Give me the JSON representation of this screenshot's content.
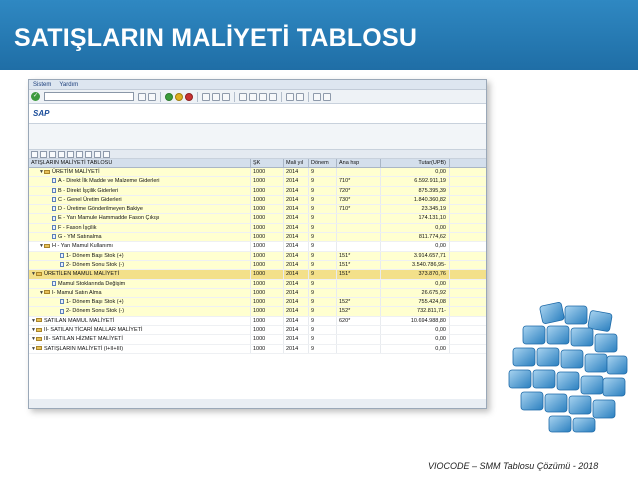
{
  "slide": {
    "title": "SATIŞLARIN MALİYETİ TABLOSU",
    "footer": "VIOCODE – SMM Tablosu Çözümü - 2018"
  },
  "sap": {
    "menu": [
      "Sistem",
      "Yardım"
    ],
    "logo": "SAP",
    "columns": {
      "name": "ATIŞLARIN MALİYETİ TABLOSU",
      "sk": "ŞK",
      "yil": "Mali yıl",
      "donem": "Dönem",
      "ana_hsp": "Ana hsp",
      "tutar": "Tutar(UPB)"
    },
    "rows": [
      {
        "indent": 1,
        "icon": "folder",
        "name": "ÜRETİM MALİYETİ",
        "sk": "1000",
        "yil": "2014",
        "donem": "9",
        "hsp": "",
        "tutar": "0,00",
        "style": "yellow"
      },
      {
        "indent": 2,
        "icon": "doc",
        "name": "A - Direkt İlk Madde ve Malzeme Giderleri",
        "sk": "1000",
        "yil": "2014",
        "donem": "9",
        "hsp": "710*",
        "tutar": "6.592.911,19",
        "style": "yellow"
      },
      {
        "indent": 2,
        "icon": "doc",
        "name": "B - Direkt İşçilik Giderleri",
        "sk": "1000",
        "yil": "2014",
        "donem": "9",
        "hsp": "720*",
        "tutar": "875.395,39",
        "style": "yellow"
      },
      {
        "indent": 2,
        "icon": "doc",
        "name": "C - Genel Üretim Giderleri",
        "sk": "1000",
        "yil": "2014",
        "donem": "9",
        "hsp": "730*",
        "tutar": "1.840.360,82",
        "style": "yellow"
      },
      {
        "indent": 2,
        "icon": "doc",
        "name": "D - Üretime Gönderilmeyen Bakiye",
        "sk": "1000",
        "yil": "2014",
        "donem": "9",
        "hsp": "710*",
        "tutar": "23.345,19",
        "style": "yellow"
      },
      {
        "indent": 2,
        "icon": "doc",
        "name": "E - Yarı Mamule Hammadde Fason Çıkışı",
        "sk": "1000",
        "yil": "2014",
        "donem": "9",
        "hsp": "",
        "tutar": "174.131,10",
        "style": "yellow"
      },
      {
        "indent": 2,
        "icon": "doc",
        "name": "F - Fason İşçilik",
        "sk": "1000",
        "yil": "2014",
        "donem": "9",
        "hsp": "",
        "tutar": "0,00",
        "style": "yellow"
      },
      {
        "indent": 2,
        "icon": "doc",
        "name": "G - YM Satınalma",
        "sk": "1000",
        "yil": "2014",
        "donem": "9",
        "hsp": "",
        "tutar": "811.774,62",
        "style": "yellow"
      },
      {
        "indent": 1,
        "icon": "folder",
        "name": "H - Yarı Mamul Kullanımı",
        "sk": "1000",
        "yil": "2014",
        "donem": "9",
        "hsp": "",
        "tutar": "0,00",
        "style": ""
      },
      {
        "indent": 3,
        "icon": "doc",
        "name": "1- Dönem Başı Stok (+)",
        "sk": "1000",
        "yil": "2014",
        "donem": "9",
        "hsp": "151*",
        "tutar": "3.914.657,71",
        "style": "yellow"
      },
      {
        "indent": 3,
        "icon": "doc",
        "name": "2- Dönem Sonu Stok (-)",
        "sk": "1000",
        "yil": "2014",
        "donem": "9",
        "hsp": "151*",
        "tutar": "3.540.786,95-",
        "style": "yellow"
      },
      {
        "indent": 0,
        "icon": "folder",
        "name": "ÜRETİLEN MAMUL MALİYETİ",
        "sk": "1000",
        "yil": "2014",
        "donem": "9",
        "hsp": "151*",
        "tutar": "373.870,76",
        "style": "sel"
      },
      {
        "indent": 2,
        "icon": "doc",
        "name": "Mamul Stoklarında Değişim",
        "sk": "1000",
        "yil": "2014",
        "donem": "9",
        "hsp": "",
        "tutar": "0,00",
        "style": "yellow"
      },
      {
        "indent": 1,
        "icon": "folder",
        "name": "I- Mamul Satın Alma",
        "sk": "1000",
        "yil": "2014",
        "donem": "9",
        "hsp": "",
        "tutar": "26.675,92",
        "style": "yellow"
      },
      {
        "indent": 3,
        "icon": "doc",
        "name": "1- Dönem Başı Stok (+)",
        "sk": "1000",
        "yil": "2014",
        "donem": "9",
        "hsp": "152*",
        "tutar": "755.424,08",
        "style": "yellow"
      },
      {
        "indent": 3,
        "icon": "doc",
        "name": "2- Dönem Sonu Stok (-)",
        "sk": "1000",
        "yil": "2014",
        "donem": "9",
        "hsp": "152*",
        "tutar": "732.811,71-",
        "style": "yellow"
      },
      {
        "indent": 0,
        "icon": "folder",
        "name": "SATILAN MAMUL MALİYETİ",
        "sk": "1000",
        "yil": "2014",
        "donem": "9",
        "hsp": "620*",
        "tutar": "10.694.988,80",
        "style": ""
      },
      {
        "indent": 0,
        "icon": "folder",
        "name": "II- SATILAN TİCARİ MALLAR MALİYETİ",
        "sk": "1000",
        "yil": "2014",
        "donem": "9",
        "hsp": "",
        "tutar": "0,00",
        "style": ""
      },
      {
        "indent": 0,
        "icon": "folder",
        "name": "III- SATILAN HİZMET MALİYETİ",
        "sk": "1000",
        "yil": "2014",
        "donem": "9",
        "hsp": "",
        "tutar": "0,00",
        "style": ""
      },
      {
        "indent": 0,
        "icon": "folder",
        "name": "SATIŞLARIN MALİYETİ (I+II+III)",
        "sk": "1000",
        "yil": "2014",
        "donem": "9",
        "hsp": "",
        "tutar": "0,00",
        "style": ""
      }
    ]
  },
  "colors": {
    "title_band": "#2f88c2",
    "row_highlight": "#ffffd0",
    "row_selected": "#f3e08a",
    "puzzle_blue": "#3f93c9"
  },
  "icons": [
    "enter-icon",
    "save-icon",
    "back-icon",
    "exit-icon",
    "cancel-icon",
    "print-icon",
    "find-icon",
    "folder-icon",
    "document-icon",
    "puzzle-icon"
  ]
}
